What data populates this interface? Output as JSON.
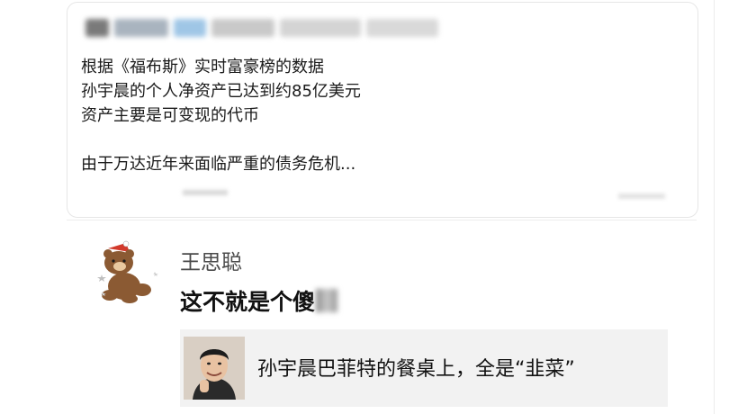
{
  "post": {
    "lines": [
      "根据《福布斯》实时富豪榜的数据",
      "孙宇晨的个人净资产已达到约85亿美元",
      "资产主要是可变现的代币",
      "由于万达近年来面临严重的债务危机..."
    ]
  },
  "comment": {
    "author": "王思聪",
    "text": "这不就是个傻",
    "quote": {
      "text": "孙宇晨巴菲特的餐桌上，全是“韭菜”"
    }
  },
  "colors": {
    "text": "#1a1a1a",
    "name": "#4a4a4a",
    "quote_bg": "#f2f2f2",
    "border": "#e6e6e6"
  }
}
